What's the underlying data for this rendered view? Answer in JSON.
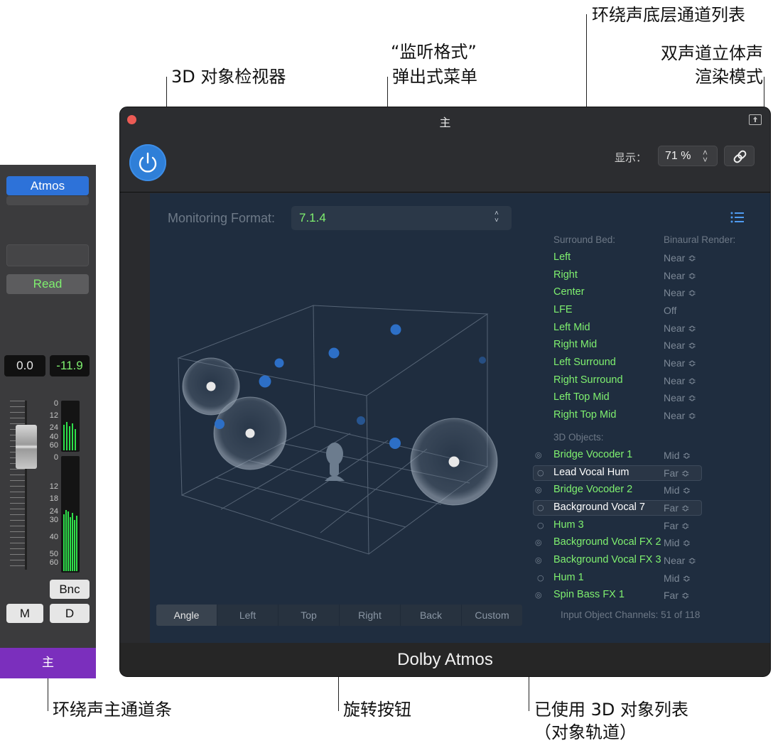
{
  "callouts": {
    "inspector": "3D 对象检视器",
    "monitoring_line1": "“监听格式”",
    "monitoring_line2": "弹出式菜单",
    "surround_bed": "环绕声底层通道列表",
    "binaural_line1": "双声道立体声",
    "binaural_line2": "渲染模式",
    "master_strip": "环绕声主通道条",
    "rotation": "旋转按钮",
    "objects_line1": "已使用 3D 对象列表",
    "objects_line2": "（对象轨道）"
  },
  "strip": {
    "output_button": "Atmos",
    "automation": "Read",
    "volume": "0.0",
    "peak": "-11.9",
    "meter_scale": [
      "0",
      "12",
      "24",
      "40",
      "60",
      "0",
      "12",
      "18",
      "24",
      "30",
      "40",
      "50",
      "60"
    ],
    "meter_level_left": 0.55,
    "meter_level_right": 0.5,
    "bounce_button": "Bnc",
    "mute_button": "M",
    "dim_button": "D",
    "name": "主",
    "name_color": "#7b2fbd"
  },
  "window": {
    "title": "主",
    "display_label": "显示：",
    "zoom": "71 %",
    "footer": "Dolby Atmos",
    "accent_color": "#2f7fd8",
    "green_text_color": "#7ff06f"
  },
  "plugin": {
    "monitoring_label": "Monitoring Format:",
    "monitoring_value": "7.1.4",
    "surround_bed_header": "Surround Bed:",
    "binaural_header": "Binaural Render:",
    "bed_channels": [
      {
        "name": "Left",
        "mode": "Near"
      },
      {
        "name": "Right",
        "mode": "Near"
      },
      {
        "name": "Center",
        "mode": "Near"
      },
      {
        "name": "LFE",
        "mode": "Off"
      },
      {
        "name": "Left Mid",
        "mode": "Near"
      },
      {
        "name": "Right Mid",
        "mode": "Near"
      },
      {
        "name": "Left Surround",
        "mode": "Near"
      },
      {
        "name": "Right Surround",
        "mode": "Near"
      },
      {
        "name": "Left Top Mid",
        "mode": "Near"
      },
      {
        "name": "Right Top Mid",
        "mode": "Near"
      }
    ],
    "objects_header": "3D Objects:",
    "objects": [
      {
        "name": "Bridge Vocoder 1",
        "mode": "Mid",
        "linked": true,
        "selected": false
      },
      {
        "name": "Lead Vocal Hum",
        "mode": "Far",
        "linked": false,
        "selected": true
      },
      {
        "name": "Bridge Vocoder 2",
        "mode": "Mid",
        "linked": true,
        "selected": false
      },
      {
        "name": "Background Vocal 7",
        "mode": "Far",
        "linked": false,
        "selected": true
      },
      {
        "name": "Hum 3",
        "mode": "Far",
        "linked": false,
        "selected": false
      },
      {
        "name": "Background Vocal FX 2",
        "mode": "Mid",
        "linked": true,
        "selected": false
      },
      {
        "name": "Background Vocal FX 3",
        "mode": "Near",
        "linked": true,
        "selected": false
      },
      {
        "name": "Hum 1",
        "mode": "Mid",
        "linked": false,
        "selected": false
      },
      {
        "name": "Spin Bass FX 1",
        "mode": "Far",
        "linked": true,
        "selected": false
      }
    ],
    "input_channels": "Input Object Channels: 51 of 118",
    "view_buttons": [
      "Angle",
      "Left",
      "Top",
      "Right",
      "Back",
      "Custom"
    ],
    "active_view": "Angle"
  }
}
